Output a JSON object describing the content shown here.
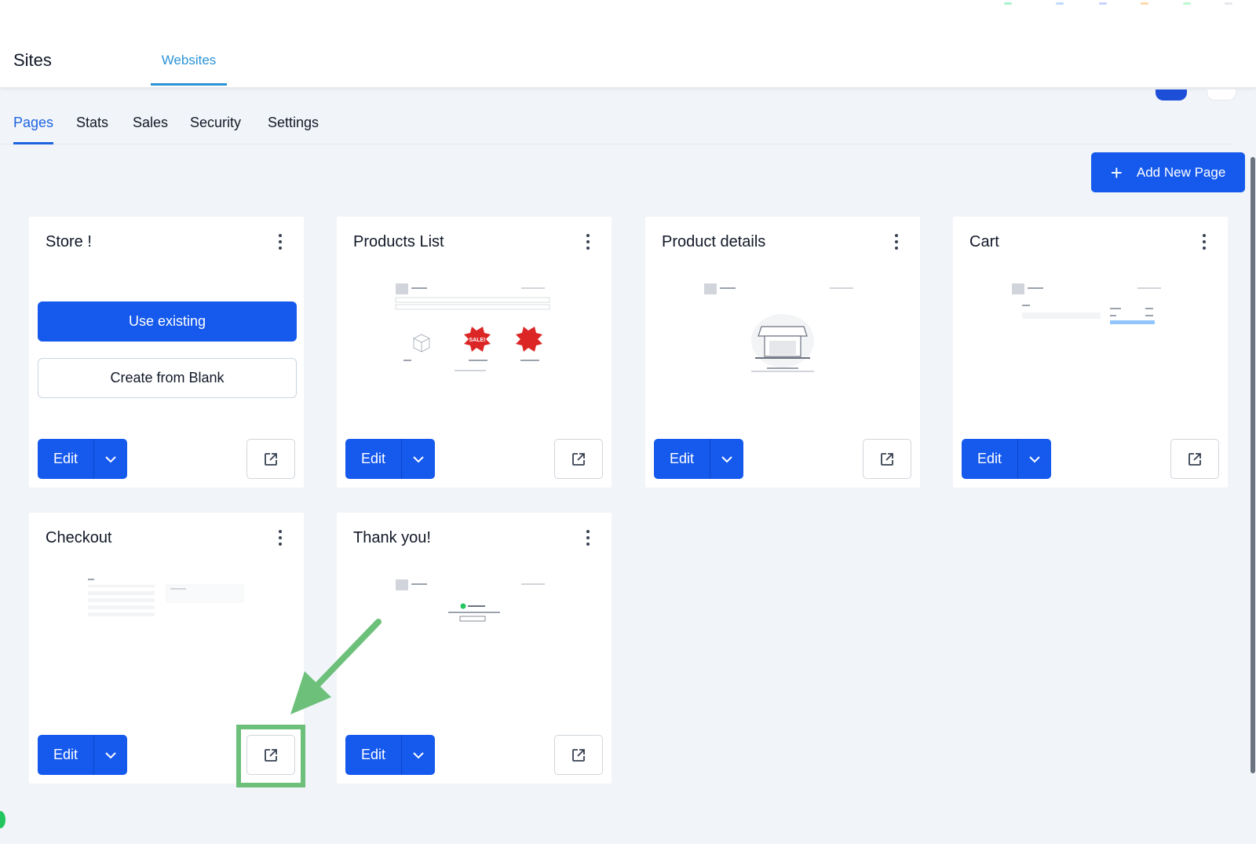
{
  "header": {
    "app_title": "Sites",
    "active_tab": "Websites"
  },
  "sub_tabs": [
    {
      "label": "Pages",
      "active": true
    },
    {
      "label": "Stats",
      "active": false
    },
    {
      "label": "Sales",
      "active": false
    },
    {
      "label": "Security",
      "active": false
    },
    {
      "label": "Settings",
      "active": false
    }
  ],
  "add_button": {
    "label": "Add New Page",
    "icon": "plus-icon"
  },
  "cards": [
    {
      "title": "Store !",
      "use_existing_label": "Use existing",
      "create_blank_label": "Create from Blank",
      "edit_label": "Edit"
    },
    {
      "title": "Products List",
      "edit_label": "Edit",
      "thumb_sale_label": "SALE!"
    },
    {
      "title": "Product details",
      "edit_label": "Edit"
    },
    {
      "title": "Cart",
      "edit_label": "Edit"
    },
    {
      "title": "Checkout",
      "edit_label": "Edit"
    },
    {
      "title": "Thank you!",
      "edit_label": "Edit"
    }
  ],
  "colors": {
    "primary": "#1559ed",
    "tab_accent": "#2a93d5",
    "background": "#f1f5f9",
    "annotation_green": "#6cc07a"
  },
  "icons": {
    "menu": "kebab-menu-icon",
    "dropdown": "chevron-down-icon",
    "open_external": "external-link-icon"
  }
}
